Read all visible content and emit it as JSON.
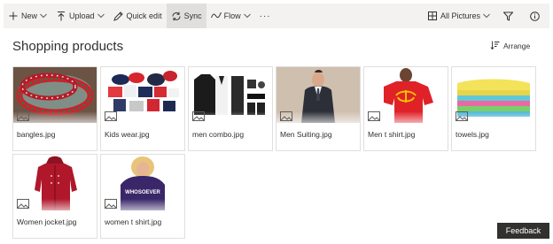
{
  "toolbar": {
    "new_label": "New",
    "upload_label": "Upload",
    "quick_edit_label": "Quick edit",
    "sync_label": "Sync",
    "flow_label": "Flow",
    "more_label": "···",
    "view_label": "All Pictures"
  },
  "library": {
    "title": "Shopping products",
    "arrange_label": "Arrange"
  },
  "files": [
    {
      "name": "bangles.jpg"
    },
    {
      "name": "Kids wear.jpg"
    },
    {
      "name": "men combo.jpg"
    },
    {
      "name": "Men Suiting.jpg"
    },
    {
      "name": "Men t shirt.jpg"
    },
    {
      "name": "towels.jpg"
    },
    {
      "name": "Women jocket.jpg"
    },
    {
      "name": "women t shirt.jpg"
    }
  ],
  "tshirt_text": "WHOSOEVER",
  "feedback_label": "Feedback",
  "colors": {
    "commandbar_bg": "#f3f2f1",
    "selected_command_bg": "#e1dfdd",
    "feedback_bg": "#323130"
  }
}
